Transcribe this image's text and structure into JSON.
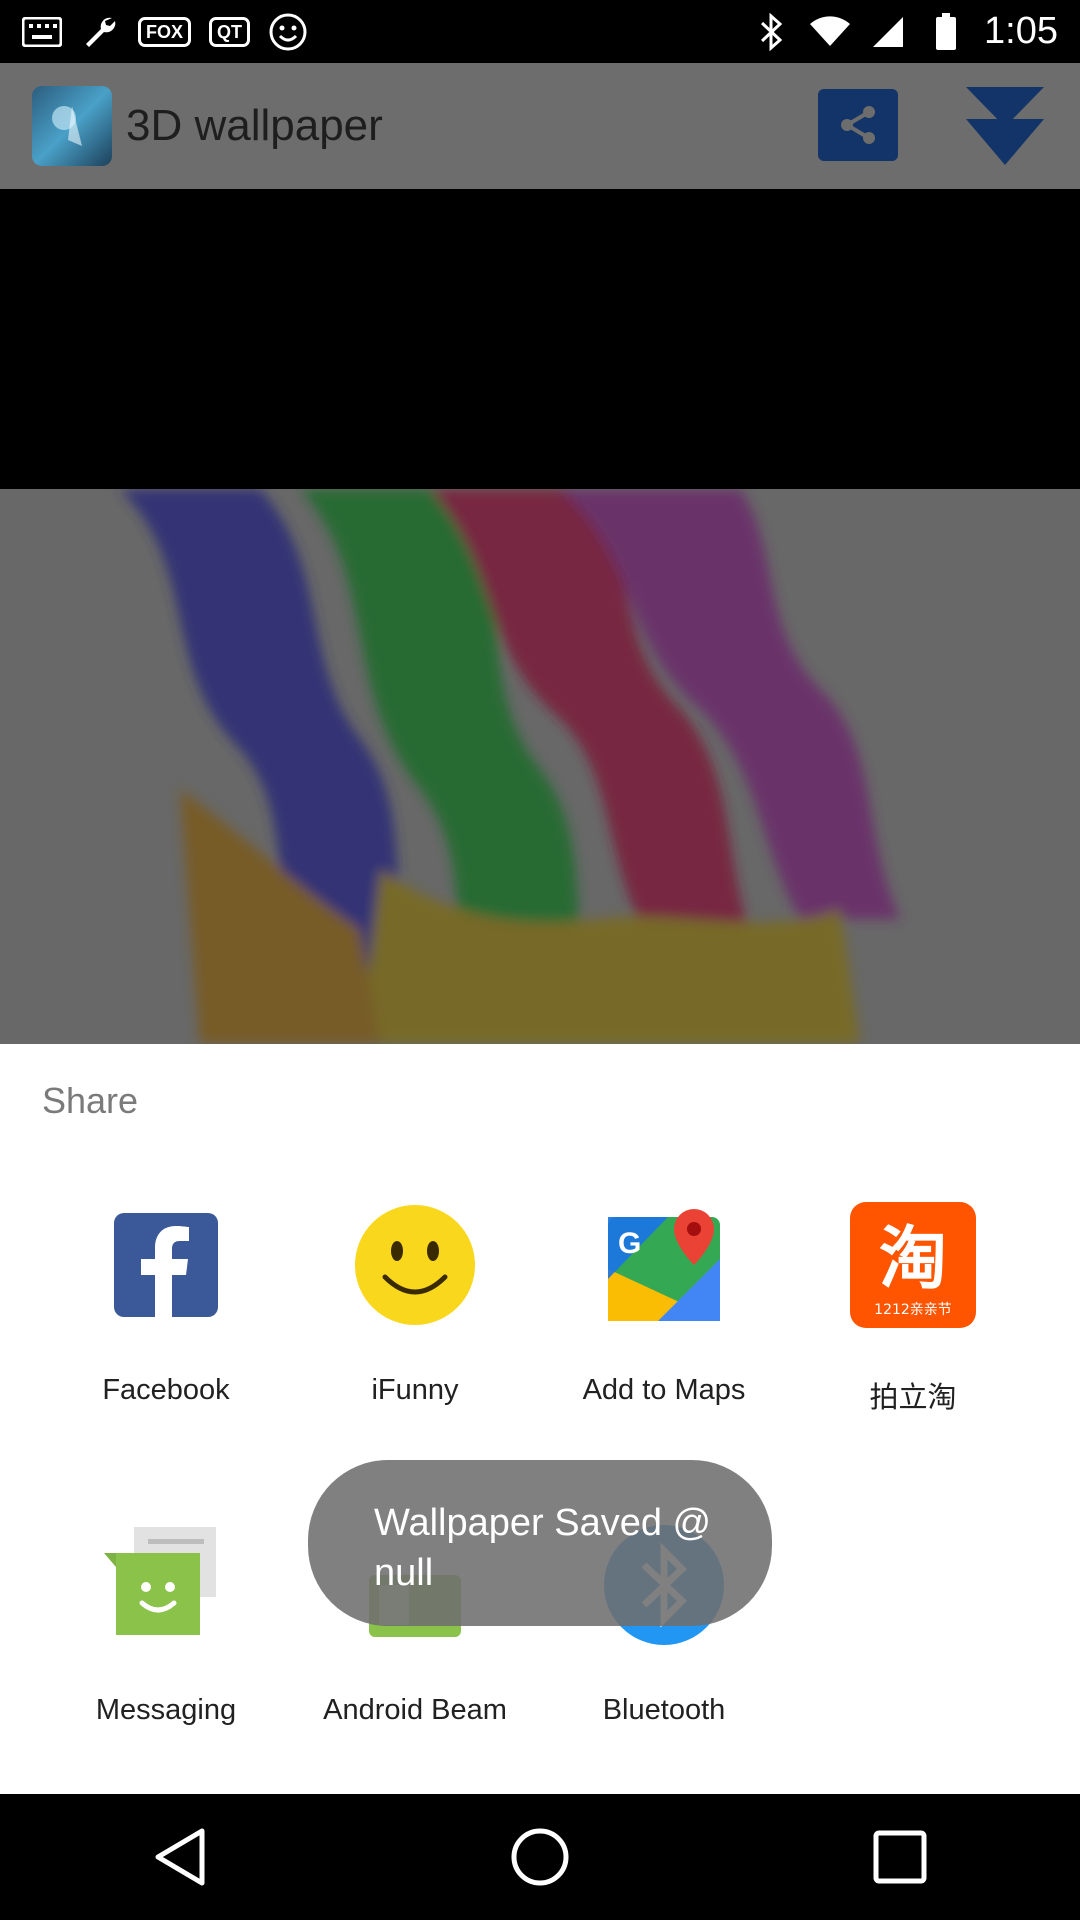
{
  "status_bar": {
    "time": "1:05",
    "notif_fox": "FOX",
    "notif_qt": "QT"
  },
  "app_bar": {
    "title": "3D wallpaper"
  },
  "share": {
    "title": "Share",
    "apps_row1": [
      {
        "label": "Facebook",
        "icon": "facebook-icon"
      },
      {
        "label": "iFunny",
        "icon": "ifunny-icon"
      },
      {
        "label": "Add to Maps",
        "icon": "maps-icon"
      },
      {
        "label": "拍立淘",
        "icon": "taobao-icon"
      }
    ],
    "apps_row2": [
      {
        "label": "Messaging",
        "icon": "messaging-icon"
      },
      {
        "label": "Android Beam",
        "icon": "android-beam-icon"
      },
      {
        "label": "Bluetooth",
        "icon": "bluetooth-icon"
      }
    ],
    "taobao_badge": "1212亲亲节"
  },
  "toast": {
    "line1": "Wallpaper Saved @",
    "line2": "null"
  },
  "colors": {
    "accent_blue": "#133468",
    "facebook": "#3b5998",
    "taobao": "#ff5500"
  }
}
